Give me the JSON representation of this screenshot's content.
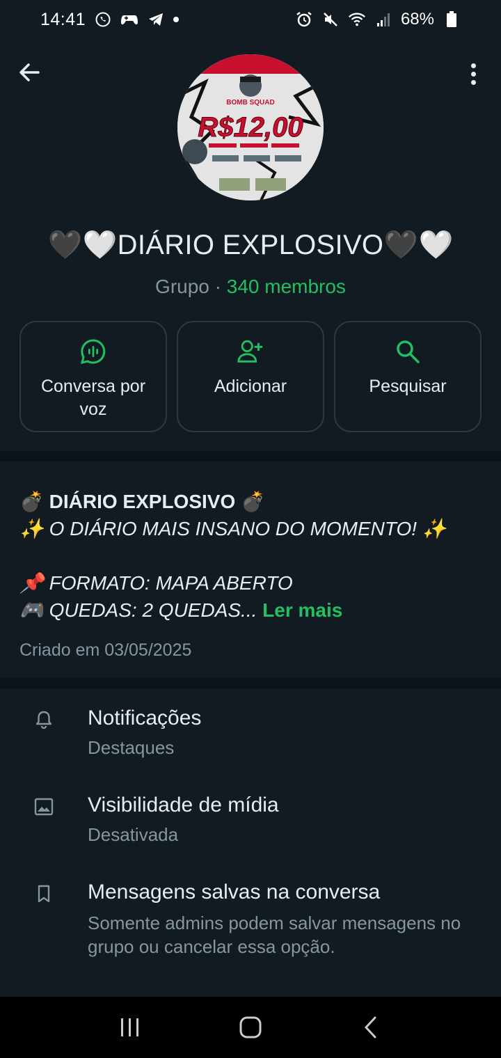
{
  "status_bar": {
    "time": "14:41",
    "battery": "68%",
    "icons": [
      "whatsapp-icon",
      "game-controller-icon",
      "telegram-icon",
      "alarm-icon",
      "mute-icon",
      "wifi-icon",
      "signal-icon",
      "battery-icon"
    ]
  },
  "header": {
    "back_icon": "arrow-left-icon",
    "menu_icon": "more-vertical-icon"
  },
  "avatar": {
    "price_text": "R$12,00",
    "logo_text": "BOMB SQUAD"
  },
  "group": {
    "title": "🖤🤍DIÁRIO EXPLOSIVO🖤🤍",
    "type_label": "Grupo · ",
    "members": "340 membros"
  },
  "actions": [
    {
      "label": "Conversa por voz",
      "icon": "voice-chat-icon"
    },
    {
      "label": "Adicionar",
      "icon": "add-person-icon"
    },
    {
      "label": "Pesquisar",
      "icon": "search-icon"
    }
  ],
  "description": {
    "line1": "💣 DIÁRIO EXPLOSIVO 💣",
    "line2": "✨ O DIÁRIO MAIS INSANO DO MOMENTO! ✨",
    "line3": "📌 FORMATO: MAPA ABERTO",
    "line4": "🎮 QUEDAS: 2 QUEDAS...",
    "read_more": "Ler mais",
    "created": "Criado em 03/05/2025"
  },
  "settings": [
    {
      "title": "Notificações",
      "subtitle": "Destaques",
      "icon": "bell-icon"
    },
    {
      "title": "Visibilidade de mídia",
      "subtitle": "Desativada",
      "icon": "image-icon"
    },
    {
      "title": "Mensagens salvas na conversa",
      "subtitle": "Somente admins podem salvar mensagens no grupo ou cancelar essa opção.",
      "icon": "bookmark-icon"
    }
  ],
  "colors": {
    "accent": "#21c063",
    "background": "#0b141a",
    "surface": "#111b21",
    "secondary_text": "#8696a0"
  }
}
